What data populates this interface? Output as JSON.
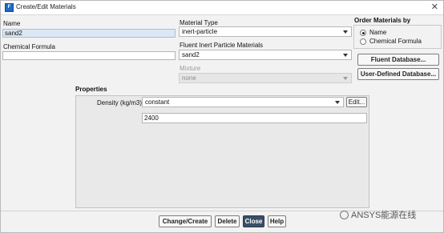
{
  "window": {
    "title": "Create/Edit Materials",
    "app_icon": "fluent-app-icon",
    "close_glyph": "✕"
  },
  "left": {
    "name_label": "Name",
    "name_value": "sand2",
    "formula_label": "Chemical Formula",
    "formula_value": ""
  },
  "middle": {
    "type_label": "Material Type",
    "type_value": "inert-particle",
    "materials_label": "Fluent Inert Particle Materials",
    "materials_value": "sand2",
    "mixture_label": "Mixture",
    "mixture_value": "none"
  },
  "order": {
    "title": "Order Materials by",
    "options": [
      {
        "label": "Name",
        "selected": true
      },
      {
        "label": "Chemical Formula",
        "selected": false
      }
    ],
    "fluent_db_button": "Fluent Database...",
    "user_db_button": "User-Defined Database..."
  },
  "properties": {
    "title": "Properties",
    "density_label": "Density (kg/m3)",
    "density_method": "constant",
    "edit_button": "Edit...",
    "density_value": "2400"
  },
  "footer": {
    "buttons": [
      "Change/Create",
      "Delete",
      "Close",
      "Help"
    ]
  },
  "watermark": "ANSYS能源在线"
}
